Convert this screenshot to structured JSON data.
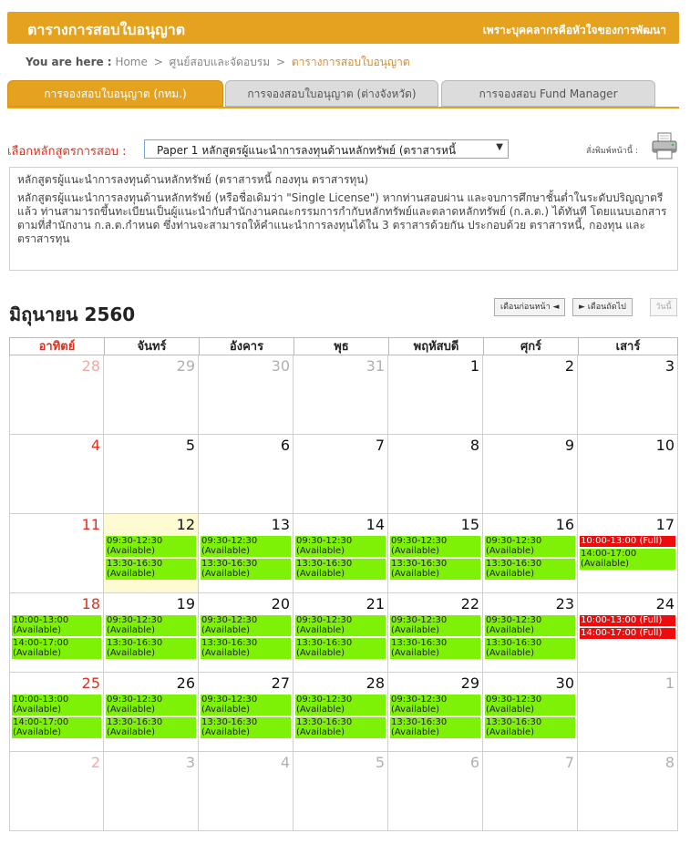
{
  "header": {
    "title": "ตารางการสอบใบอนุญาต",
    "slogan": "เพราะบุคคลากรคือหัวใจของการพัฒนา"
  },
  "breadcrumb": {
    "label": "You are here :",
    "items": [
      "Home",
      "ศูนย์สอบและจัดอบรม",
      "ตารางการสอบใบอนุญาต"
    ]
  },
  "tabs": [
    {
      "label": "การจองสอบใบอนุญาต (กทม.)",
      "active": true
    },
    {
      "label": "การจองสอบใบอนุญาต (ต่างจังหวัด)",
      "active": false
    },
    {
      "label": "การจองสอบ Fund Manager",
      "active": false
    }
  ],
  "course": {
    "label": "เลือกหลักสูตรการสอบ :",
    "selected": "Paper 1 หลักสูตรผู้แนะนำการลงทุนด้านหลักทรัพย์ (ตราสารหนี้"
  },
  "print": {
    "label": "สั่งพิมพ์หน้านี้ :"
  },
  "description": {
    "title": "หลักสูตรผู้แนะนำการลงทุนด้านหลักทรัพย์ (ตราสารหนี้ กองทุน ตราสารทุน)",
    "body": "หลักสูตรผู้แนะนำการลงทุนด้านหลักทรัพย์ (หรือชื่อเดิมว่า \"Single License\") หากท่านสอบผ่าน และจบการศึกษาชั้นต่ำในระดับปริญญาตรีแล้ว ท่านสามารถขึ้นทะเบียนเป็นผู้แนะนำกับสำนักงานคณะกรรมการกำกับหลักทรัพย์และตลาดหลักทรัพย์ (ก.ล.ต.) ได้ทันที โดยแนบเอกสารตามที่สำนักงาน ก.ล.ต.กำหนด ซึ่งท่านจะสามารถให้คำแนะนำการลงทุนได้ใน 3 ตราสารด้วยกัน ประกอบด้วย ตราสารหนี้, กองทุน และตราสารทุน"
  },
  "calendar": {
    "month_title": "มิถุนายน 2560",
    "prev_label": "เดือนก่อนหน้า ◄",
    "next_label": "► เดือนถัดไป",
    "today_label": "วันนี้",
    "weekdays": [
      "อาทิตย์",
      "จันทร์",
      "อังคาร",
      "พุธ",
      "พฤหัสบดี",
      "ศุกร์",
      "เสาร์"
    ],
    "weeks": [
      [
        {
          "day": "28",
          "other": true,
          "slots": []
        },
        {
          "day": "29",
          "other": true,
          "slots": []
        },
        {
          "day": "30",
          "other": true,
          "slots": []
        },
        {
          "day": "31",
          "other": true,
          "slots": []
        },
        {
          "day": "1",
          "slots": []
        },
        {
          "day": "2",
          "slots": []
        },
        {
          "day": "3",
          "slots": []
        }
      ],
      [
        {
          "day": "4",
          "slots": []
        },
        {
          "day": "5",
          "slots": []
        },
        {
          "day": "6",
          "slots": []
        },
        {
          "day": "7",
          "slots": []
        },
        {
          "day": "8",
          "slots": []
        },
        {
          "day": "9",
          "slots": []
        },
        {
          "day": "10",
          "slots": []
        }
      ],
      [
        {
          "day": "11",
          "slots": []
        },
        {
          "day": "12",
          "today": true,
          "slots": [
            {
              "time": "09:30-12:30",
              "status": "(Available)"
            },
            {
              "time": "13:30-16:30",
              "status": "(Available)"
            }
          ]
        },
        {
          "day": "13",
          "slots": [
            {
              "time": "09:30-12:30",
              "status": "(Available)"
            },
            {
              "time": "13:30-16:30",
              "status": "(Available)"
            }
          ]
        },
        {
          "day": "14",
          "slots": [
            {
              "time": "09:30-12:30",
              "status": "(Available)"
            },
            {
              "time": "13:30-16:30",
              "status": "(Available)"
            }
          ]
        },
        {
          "day": "15",
          "slots": [
            {
              "time": "09:30-12:30",
              "status": "(Available)"
            },
            {
              "time": "13:30-16:30",
              "status": "(Available)"
            }
          ]
        },
        {
          "day": "16",
          "slots": [
            {
              "time": "09:30-12:30",
              "status": "(Available)"
            },
            {
              "time": "13:30-16:30",
              "status": "(Available)"
            }
          ]
        },
        {
          "day": "17",
          "slots": [
            {
              "time": "10:00-13:00",
              "status": "(Full)",
              "full": true
            },
            {
              "time": "14:00-17:00",
              "status": "(Available)"
            }
          ]
        }
      ],
      [
        {
          "day": "18",
          "slots": [
            {
              "time": "10:00-13:00",
              "status": "(Available)"
            },
            {
              "time": "14:00-17:00",
              "status": "(Available)"
            }
          ]
        },
        {
          "day": "19",
          "slots": [
            {
              "time": "09:30-12:30",
              "status": "(Available)"
            },
            {
              "time": "13:30-16:30",
              "status": "(Available)"
            }
          ]
        },
        {
          "day": "20",
          "slots": [
            {
              "time": "09:30-12:30",
              "status": "(Available)"
            },
            {
              "time": "13:30-16:30",
              "status": "(Available)"
            }
          ]
        },
        {
          "day": "21",
          "slots": [
            {
              "time": "09:30-12:30",
              "status": "(Available)"
            },
            {
              "time": "13:30-16:30",
              "status": "(Available)"
            }
          ]
        },
        {
          "day": "22",
          "slots": [
            {
              "time": "09:30-12:30",
              "status": "(Available)"
            },
            {
              "time": "13:30-16:30",
              "status": "(Available)"
            }
          ]
        },
        {
          "day": "23",
          "slots": [
            {
              "time": "09:30-12:30",
              "status": "(Available)"
            },
            {
              "time": "13:30-16:30",
              "status": "(Available)"
            }
          ]
        },
        {
          "day": "24",
          "slots": [
            {
              "time": "10:00-13:00",
              "status": "(Full)",
              "full": true
            },
            {
              "time": "14:00-17:00",
              "status": "(Full)",
              "full": true
            }
          ]
        }
      ],
      [
        {
          "day": "25",
          "slots": [
            {
              "time": "10:00-13:00",
              "status": "(Available)"
            },
            {
              "time": "14:00-17:00",
              "status": "(Available)"
            }
          ]
        },
        {
          "day": "26",
          "slots": [
            {
              "time": "09:30-12:30",
              "status": "(Available)"
            },
            {
              "time": "13:30-16:30",
              "status": "(Available)"
            }
          ]
        },
        {
          "day": "27",
          "slots": [
            {
              "time": "09:30-12:30",
              "status": "(Available)"
            },
            {
              "time": "13:30-16:30",
              "status": "(Available)"
            }
          ]
        },
        {
          "day": "28",
          "slots": [
            {
              "time": "09:30-12:30",
              "status": "(Available)"
            },
            {
              "time": "13:30-16:30",
              "status": "(Available)"
            }
          ]
        },
        {
          "day": "29",
          "slots": [
            {
              "time": "09:30-12:30",
              "status": "(Available)"
            },
            {
              "time": "13:30-16:30",
              "status": "(Available)"
            }
          ]
        },
        {
          "day": "30",
          "slots": [
            {
              "time": "09:30-12:30",
              "status": "(Available)"
            },
            {
              "time": "13:30-16:30",
              "status": "(Available)"
            }
          ]
        },
        {
          "day": "1",
          "other": true,
          "slots": []
        }
      ],
      [
        {
          "day": "2",
          "other": true,
          "slots": []
        },
        {
          "day": "3",
          "other": true,
          "slots": []
        },
        {
          "day": "4",
          "other": true,
          "slots": []
        },
        {
          "day": "5",
          "other": true,
          "slots": []
        },
        {
          "day": "6",
          "other": true,
          "slots": []
        },
        {
          "day": "7",
          "other": true,
          "slots": []
        },
        {
          "day": "8",
          "other": true,
          "slots": []
        }
      ]
    ]
  },
  "colors": {
    "brand": "#e5a21e",
    "available": "#7ef206",
    "full": "#ef0b0b",
    "sunday": "#e0301e",
    "today": "#fefbd2"
  }
}
